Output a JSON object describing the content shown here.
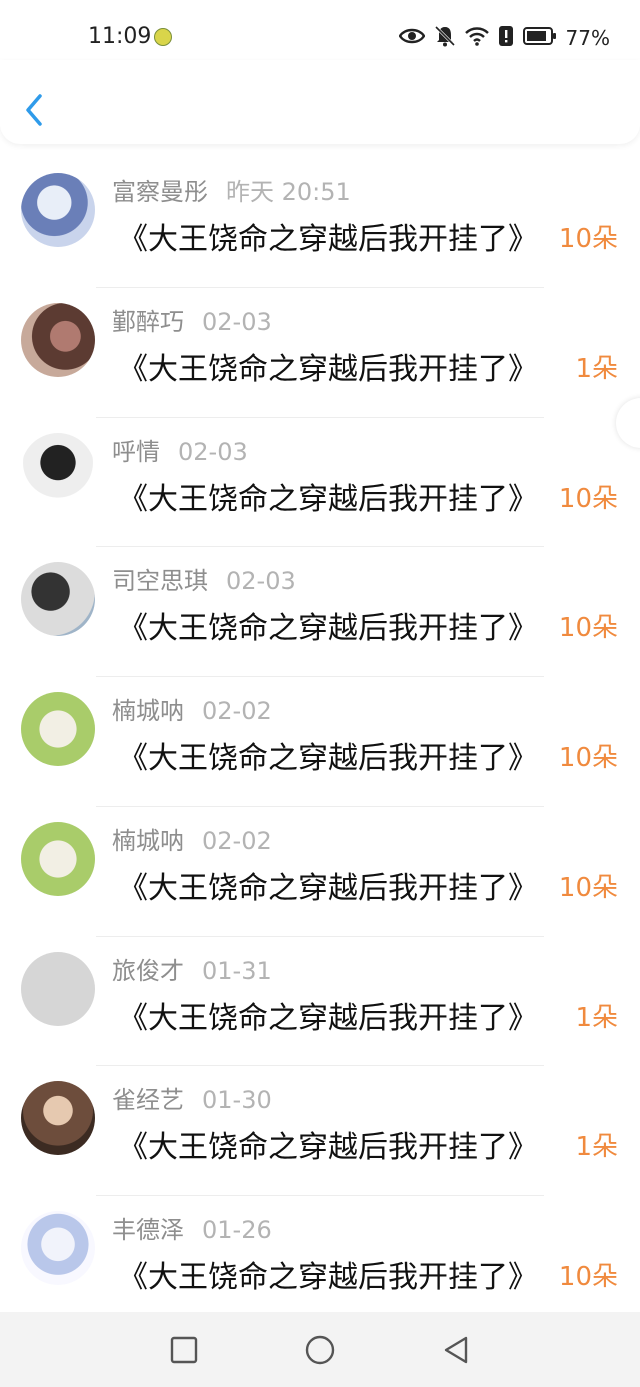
{
  "status_bar": {
    "time": "11:09",
    "battery": "77%",
    "icons": [
      "eye-icon",
      "mute-bell-icon",
      "wifi-icon",
      "alert-icon",
      "battery-icon"
    ]
  },
  "header": {
    "back_icon": "chevron-left-icon"
  },
  "colors": {
    "accent_blue": "#2f9bea",
    "amount_orange": "#f08a3e"
  },
  "list": [
    {
      "name": "富察曼彤",
      "date": "昨天 20:51",
      "title": "《大王饶命之穿越后我开挂了》",
      "amount": "10朵"
    },
    {
      "name": "鄞醉巧",
      "date": "02-03",
      "title": "《大王饶命之穿越后我开挂了》",
      "amount": "1朵"
    },
    {
      "name": "呼情",
      "date": "02-03",
      "title": "《大王饶命之穿越后我开挂了》",
      "amount": "10朵"
    },
    {
      "name": "司空思琪",
      "date": "02-03",
      "title": "《大王饶命之穿越后我开挂了》",
      "amount": "10朵"
    },
    {
      "name": "楠城呐",
      "date": "02-02",
      "title": "《大王饶命之穿越后我开挂了》",
      "amount": "10朵"
    },
    {
      "name": "楠城呐",
      "date": "02-02",
      "title": "《大王饶命之穿越后我开挂了》",
      "amount": "10朵"
    },
    {
      "name": "旅俊才",
      "date": "01-31",
      "title": "《大王饶命之穿越后我开挂了》",
      "amount": "1朵"
    },
    {
      "name": "雀经艺",
      "date": "01-30",
      "title": "《大王饶命之穿越后我开挂了》",
      "amount": "1朵"
    },
    {
      "name": "丰德泽",
      "date": "01-26",
      "title": "《大王饶命之穿越后我开挂了》",
      "amount": "10朵"
    }
  ],
  "nav_bar": {
    "buttons": [
      "recent-apps-icon",
      "home-icon",
      "back-triangle-icon"
    ]
  }
}
